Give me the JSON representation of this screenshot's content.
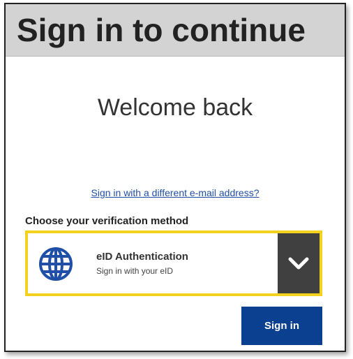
{
  "header": {
    "title": "Sign in to continue"
  },
  "main": {
    "welcome_text": "Welcome back",
    "alternate_email_link": "Sign in with a different e-mail address?",
    "method_label": "Choose your verification method",
    "selected_method": {
      "title": "eID Authentication",
      "subtitle": "Sign in with your eID",
      "icon": "globe-icon"
    },
    "dropdown_icon": "chevron-down-icon",
    "sign_in_label": "Sign in"
  },
  "colors": {
    "header_background": "#d3d3d3",
    "selection_border": "#f3d11f",
    "dropdown_background": "#404040",
    "primary_button": "#0b3f8f",
    "globe_icon": "#1f4fa6",
    "link": "#1f4fa6"
  }
}
